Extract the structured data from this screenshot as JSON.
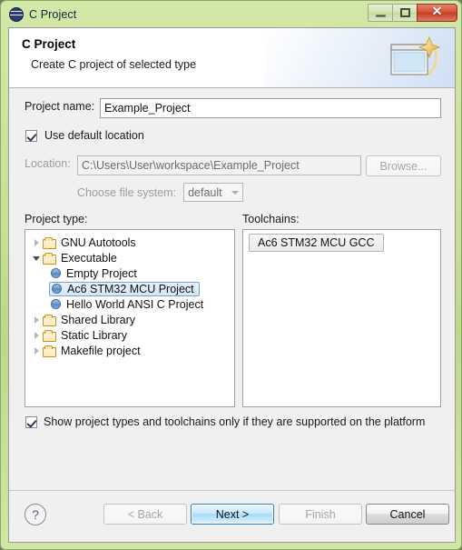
{
  "window": {
    "title": "C Project",
    "icon": "eclipse-circle-icon",
    "controls": {
      "minimize": "minimize-icon",
      "maximize": "maximize-icon",
      "close": "✕"
    }
  },
  "banner": {
    "title": "C Project",
    "subtitle": "Create C project of selected type",
    "icon": "new-project-wizard-icon"
  },
  "form": {
    "project_name_label": "Project name:",
    "project_name_value": "Example_Project",
    "project_name_placeholder": "",
    "use_default_location_label": "Use default location",
    "use_default_location_checked": true,
    "location_label": "Location:",
    "location_value": "C:\\Users\\User\\workspace\\Example_Project",
    "browse_label": "Browse...",
    "file_system_label": "Choose file system:",
    "file_system_value": "default",
    "file_system_options": [
      "default"
    ]
  },
  "project_type": {
    "label": "Project type:",
    "items": [
      {
        "label": "GNU Autotools",
        "type": "folder",
        "state": "collapsed",
        "indent": 0,
        "selected": false
      },
      {
        "label": "Executable",
        "type": "folder",
        "state": "expanded",
        "indent": 0,
        "selected": false
      },
      {
        "label": "Empty Project",
        "type": "leaf",
        "state": "none",
        "indent": 1,
        "selected": false
      },
      {
        "label": "Ac6 STM32 MCU Project",
        "type": "leaf",
        "state": "none",
        "indent": 1,
        "selected": true
      },
      {
        "label": "Hello World ANSI C Project",
        "type": "leaf",
        "state": "none",
        "indent": 1,
        "selected": false
      },
      {
        "label": "Shared Library",
        "type": "folder",
        "state": "collapsed",
        "indent": 0,
        "selected": false
      },
      {
        "label": "Static Library",
        "type": "folder",
        "state": "collapsed",
        "indent": 0,
        "selected": false
      },
      {
        "label": "Makefile project",
        "type": "folder",
        "state": "collapsed",
        "indent": 0,
        "selected": false
      }
    ]
  },
  "toolchains": {
    "label": "Toolchains:",
    "items": [
      {
        "label": "Ac6 STM32 MCU GCC",
        "selected": true
      }
    ]
  },
  "options": {
    "show_supported_label": "Show project types and toolchains only if they are supported on the platform",
    "show_supported_checked": true
  },
  "footer": {
    "help": "?",
    "back_label": "< Back",
    "back_enabled": false,
    "next_label": "Next >",
    "next_enabled": true,
    "finish_label": "Finish",
    "finish_enabled": false,
    "cancel_label": "Cancel",
    "cancel_enabled": true
  },
  "colors": {
    "frame_green": "#c7e094",
    "close_red": "#d8513a",
    "selection_blue": "#d2e7fa",
    "default_button_blue": "#a5dcf8",
    "folder_orange": "#ffe9b0",
    "leaf_blue": "#4f82bb"
  }
}
